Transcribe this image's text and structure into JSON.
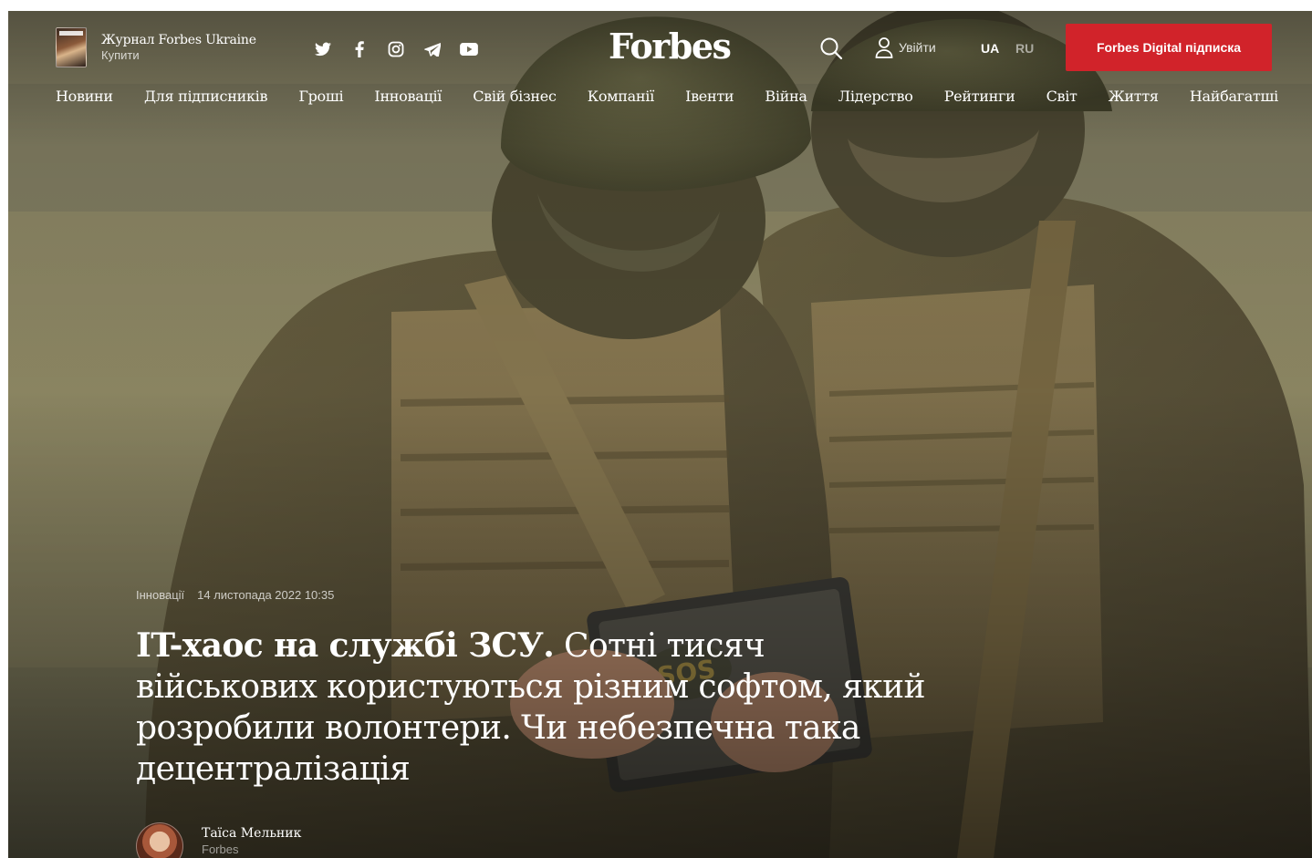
{
  "header": {
    "magazine_title": "Журнал Forbes Ukraine",
    "magazine_buy": "Купити",
    "socials": [
      "twitter-icon",
      "facebook-icon",
      "instagram-icon",
      "telegram-icon",
      "youtube-icon"
    ],
    "logo": "Forbes",
    "login_label": "Увійти",
    "lang_ua": "UA",
    "lang_ru": "RU",
    "subscribe_label": "Forbes Digital підписка",
    "accent_color": "#d1232a"
  },
  "nav": {
    "items": [
      "Новини",
      "Для підписників",
      "Гроші",
      "Інновації",
      "Свій бізнес",
      "Компанії",
      "Івенти",
      "Війна",
      "Лідерство",
      "Рейтинги",
      "Світ",
      "Життя",
      "Найбагатші"
    ]
  },
  "article": {
    "category": "Інновації",
    "date": "14 листопада 2022 10:35",
    "headline_bold": "IT-хаос на службі ЗСУ.",
    "headline_rest": " Сотні тисяч військових користуються різним софтом, який розробили волонтери. Чи небезпечна така децентралізація",
    "author_name": "Таїса Мельник",
    "author_org": "Forbes"
  }
}
